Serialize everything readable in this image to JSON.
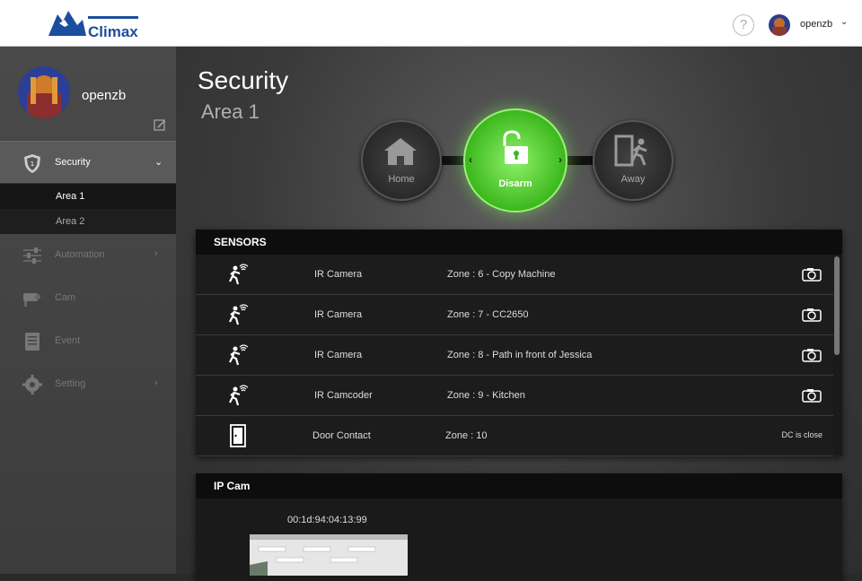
{
  "brand": {
    "name": "Climax",
    "primary_color": "#1c4e9e"
  },
  "topbar": {
    "help_icon": "question-icon",
    "username": "openzb"
  },
  "sidebar": {
    "profile_name": "openzb",
    "items": [
      {
        "label": "Security",
        "icon": "shield-icon"
      },
      {
        "label": "Automation",
        "icon": "sliders-icon"
      },
      {
        "label": "Cam",
        "icon": "camera-icon"
      },
      {
        "label": "Event",
        "icon": "list-icon"
      },
      {
        "label": "Setting",
        "icon": "gear-icon"
      }
    ],
    "security_subitems": [
      "Area 1",
      "Area 2"
    ]
  },
  "page": {
    "title": "Security",
    "subtitle": "Area 1"
  },
  "modes": {
    "home": "Home",
    "disarm": "Disarm",
    "away": "Away",
    "active": "disarm",
    "active_color": "#3cb81c"
  },
  "sensors": {
    "title": "SENSORS",
    "rows": [
      {
        "type": "IR Camera",
        "zone": "Zone : 6 - Copy Machine",
        "icon": "motion-icon",
        "action": "camera-icon"
      },
      {
        "type": "IR Camera",
        "zone": "Zone : 7 - CC2650",
        "icon": "motion-icon",
        "action": "camera-icon"
      },
      {
        "type": "IR Camera",
        "zone": "Zone : 8 - Path in front of Jessica",
        "icon": "motion-icon",
        "action": "camera-icon"
      },
      {
        "type": "IR Camcoder",
        "zone": "Zone : 9 - Kitchen",
        "icon": "motion-icon",
        "action": "camera-icon"
      },
      {
        "type": "Door Contact",
        "zone": "Zone : 10",
        "icon": "door-icon",
        "status": "DC is close"
      }
    ]
  },
  "ipcam": {
    "title": "IP Cam",
    "device_id": "00:1d:94:04:13:99"
  }
}
